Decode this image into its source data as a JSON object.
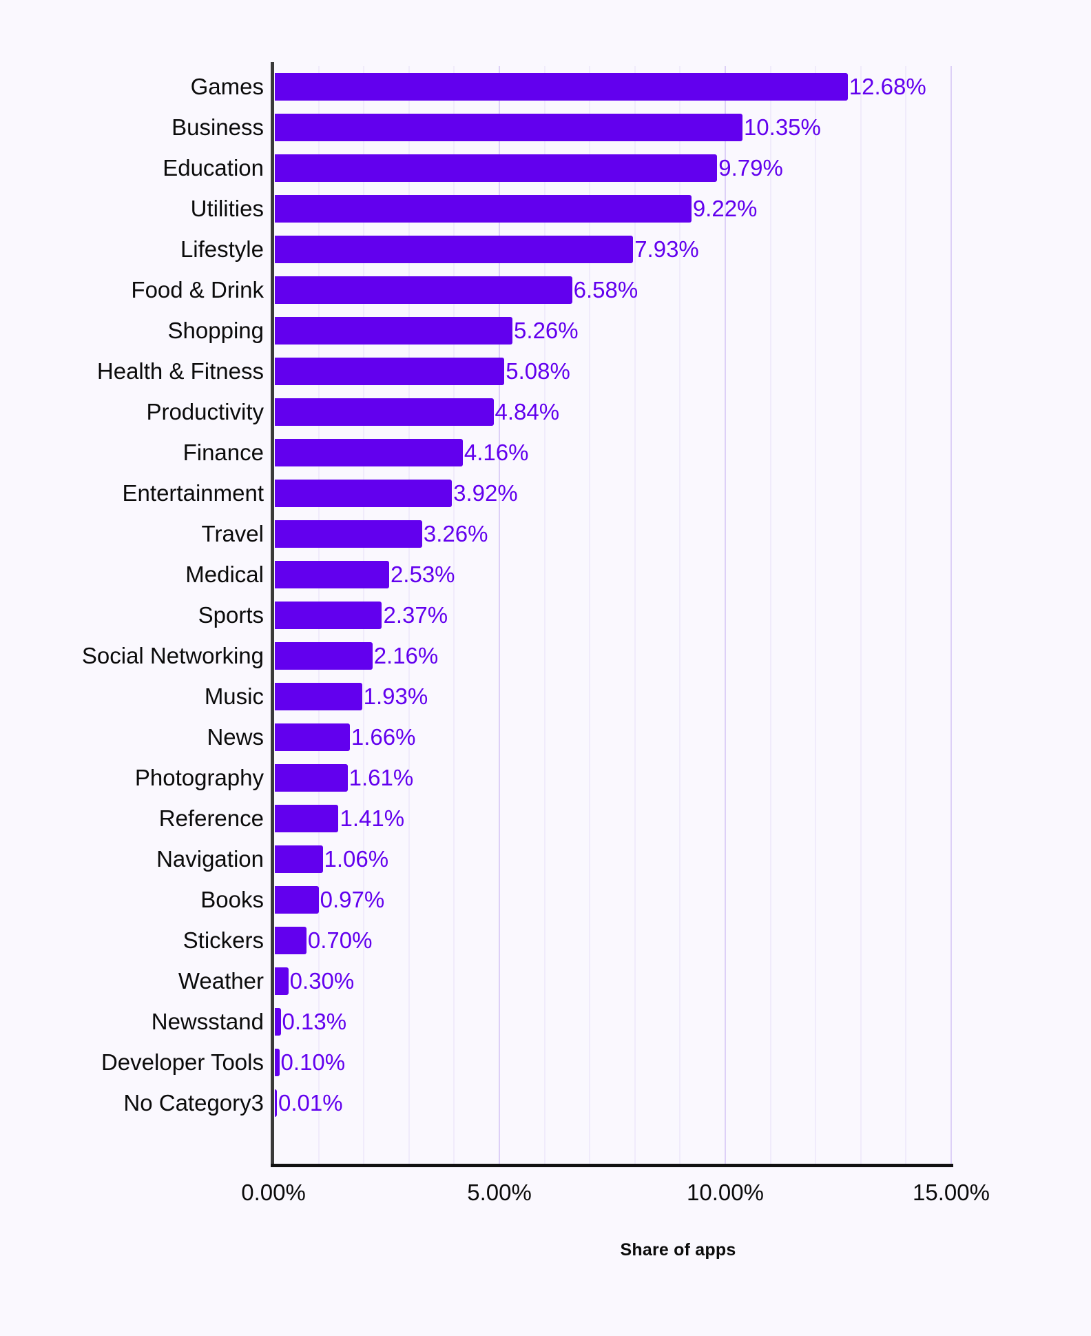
{
  "chart_data": {
    "type": "bar",
    "orientation": "horizontal",
    "title": "",
    "subtitle": "",
    "xlabel": "Share of apps",
    "ylabel": "",
    "xlim": [
      0,
      15
    ],
    "ylim": null,
    "grid": true,
    "legend": null,
    "legend_position": "none",
    "value_suffix": "%",
    "xtick_labels": [
      "0.00%",
      "5.00%",
      "10.00%",
      "15.00%"
    ],
    "xtick_values": [
      0,
      5,
      10,
      15
    ],
    "gridline_interval": 1,
    "major_gridline_interval": 5,
    "categories": [
      "Games",
      "Business",
      "Education",
      "Utilities",
      "Lifestyle",
      "Food & Drink",
      "Shopping",
      "Health & Fitness",
      "Productivity",
      "Finance",
      "Entertainment",
      "Travel",
      "Medical",
      "Sports",
      "Social Networking",
      "Music",
      "News",
      "Photography",
      "Reference",
      "Navigation",
      "Books",
      "Stickers",
      "Weather",
      "Newsstand",
      "Developer Tools",
      "No Category3"
    ],
    "values": [
      12.68,
      10.35,
      9.79,
      9.22,
      7.93,
      6.58,
      5.26,
      5.08,
      4.84,
      4.16,
      3.92,
      3.26,
      2.53,
      2.37,
      2.16,
      1.93,
      1.66,
      1.61,
      1.41,
      1.06,
      0.97,
      0.7,
      0.3,
      0.13,
      0.1,
      0.01
    ],
    "value_labels": [
      "12.68%",
      "10.35%",
      "9.79%",
      "9.22%",
      "7.93%",
      "6.58%",
      "5.26%",
      "5.08%",
      "4.84%",
      "4.16%",
      "3.92%",
      "3.26%",
      "2.53%",
      "2.37%",
      "2.16%",
      "1.93%",
      "1.66%",
      "1.61%",
      "1.41%",
      "1.06%",
      "0.97%",
      "0.70%",
      "0.30%",
      "0.13%",
      "0.10%",
      "0.01%"
    ],
    "colors": {
      "bar": "#6200ee",
      "value_label": "#6200ee",
      "category_label": "#0b0b0b",
      "tick_label": "#0b0b0b",
      "axis_title": "#0b0b0b",
      "background": "#faf8fe",
      "gridline": "#f0ebfb",
      "gridline_major": "#ddd0f7",
      "axis_line": "#111111"
    }
  }
}
